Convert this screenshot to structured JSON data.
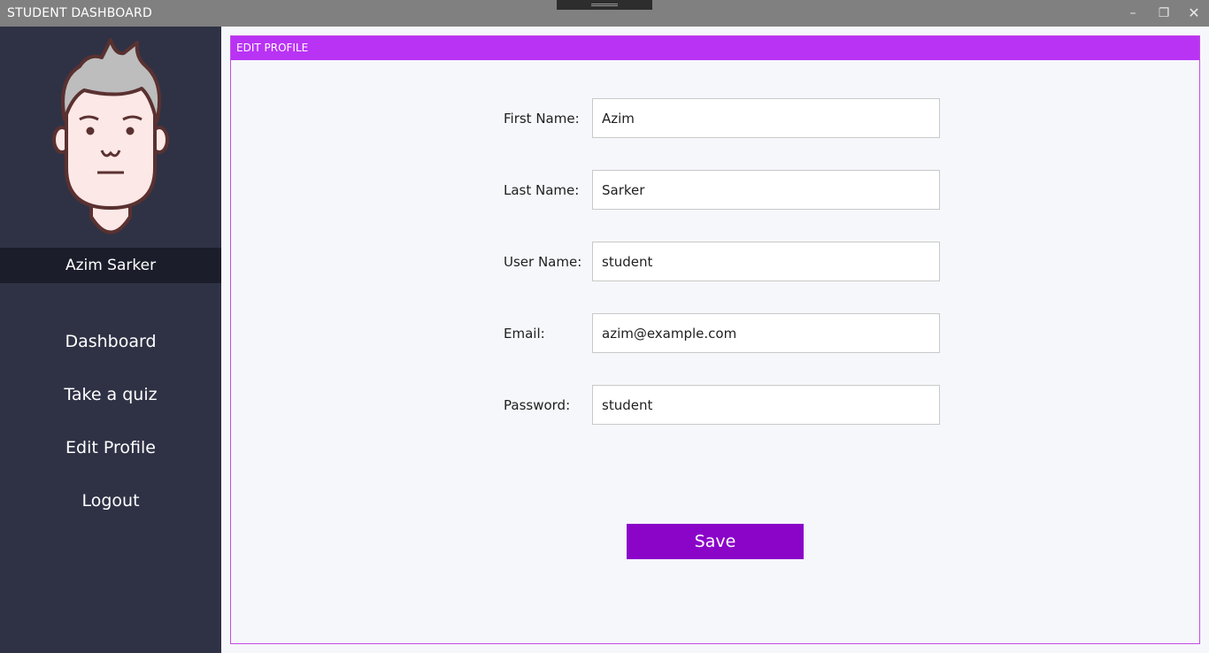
{
  "window": {
    "title": "STUDENT DASHBOARD",
    "minimize_glyph": "–",
    "maximize_glyph": "❐",
    "close_glyph": "✕"
  },
  "sidebar": {
    "user_name": "Azim Sarker",
    "items": [
      {
        "label": "Dashboard"
      },
      {
        "label": "Take a quiz"
      },
      {
        "label": "Edit Profile"
      },
      {
        "label": "Logout"
      }
    ]
  },
  "panel": {
    "header": "EDIT PROFILE",
    "fields": [
      {
        "label": "First Name:",
        "value": "Azim"
      },
      {
        "label": "Last Name:",
        "value": "Sarker"
      },
      {
        "label": "User Name:",
        "value": "student"
      },
      {
        "label": "Email:",
        "value": "azim@example.com"
      },
      {
        "label": "Password:",
        "value": "student"
      }
    ],
    "save_label": "Save"
  },
  "colors": {
    "sidebar_bg": "#2f3245",
    "name_bar_bg": "#1b1d2a",
    "header_bg": "#b933f5",
    "button_bg": "#8b05c9",
    "titlebar_bg": "#808080"
  },
  "icons": [
    "avatar-icon",
    "minimize-icon",
    "maximize-icon",
    "close-icon"
  ]
}
